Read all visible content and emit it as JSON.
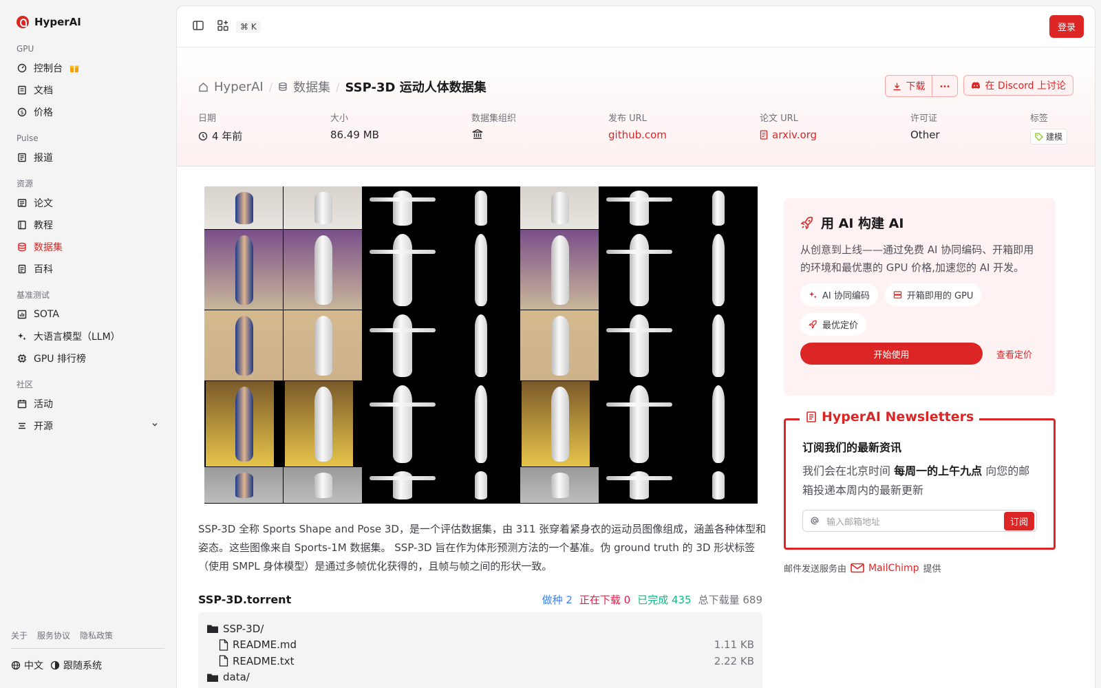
{
  "sidebar": {
    "brand": "HyperAI",
    "sections": [
      {
        "title": "GPU"
      },
      {
        "title": "Pulse"
      },
      {
        "title": "资源"
      },
      {
        "title": "基准测试"
      },
      {
        "title": "社区"
      }
    ],
    "items": {
      "console": "控制台",
      "docs": "文档",
      "pricing": "价格",
      "news": "报道",
      "papers": "论文",
      "tutorials": "教程",
      "datasets": "数据集",
      "wiki": "百科",
      "sota": "SOTA",
      "llm": "大语言模型（LLM）",
      "gpu_rank": "GPU 排行榜",
      "events": "活动",
      "open_source": "开源"
    },
    "footer_links": [
      "关于",
      "服务协议",
      "隐私政策"
    ],
    "language": "中文",
    "theme": "跟随系统"
  },
  "topbar": {
    "shortcut": "⌘ K",
    "login": "登录"
  },
  "breadcrumb": {
    "home": "HyperAI",
    "datasets": "数据集",
    "current": "SSP-3D 运动人体数据集"
  },
  "actions": {
    "download": "下载",
    "discord": "在 Discord 上讨论"
  },
  "meta": {
    "date_label": "日期",
    "date_value": "4 年前",
    "size_label": "大小",
    "size_value": "86.49 MB",
    "org_label": "数据集组织",
    "release_label": "发布 URL",
    "release_value": "github.com",
    "paper_label": "论文 URL",
    "paper_value": "arxiv.org",
    "license_label": "许可证",
    "license_value": "Other",
    "tags_label": "标签",
    "tag_value": "建模"
  },
  "description": "SSP-3D 全称 Sports Shape and Pose 3D，是一个评估数据集，由 311 张穿着紧身衣的运动员图像组成，涵盖各种体型和姿态。这些图像来自 Sports-1M 数据集。 SSP-3D 旨在作为体形预测方法的一个基准。伪 ground truth 的 3D 形状标签（使用 SMPL 身体模型）是通过多帧优化获得的，且帧与帧之间的形状一致。",
  "torrent": {
    "name": "SSP-3D.torrent",
    "seeding": "做种 2",
    "downloading": "正在下载 0",
    "completed": "已完成 435",
    "total": "总下载量 689",
    "colors": {
      "seeding": "#3b82f6",
      "downloading": "#e11d48",
      "completed": "#10b981",
      "total": "#71717a"
    },
    "files": [
      {
        "name": "SSP-3D/",
        "size": "",
        "type": "folder"
      },
      {
        "name": "README.md",
        "size": "1.11 KB",
        "type": "file"
      },
      {
        "name": "README.txt",
        "size": "2.22 KB",
        "type": "file"
      },
      {
        "name": "data/",
        "size": "",
        "type": "folder"
      }
    ]
  },
  "promo": {
    "title": "用 AI 构建 AI",
    "text": "从创意到上线——通过免费 AI 协同编码、开箱即用的环境和最优惠的 GPU 价格,加速您的 AI 开发。",
    "chips": [
      "AI 协同编码",
      "开箱即用的 GPU",
      "最优定价"
    ],
    "start": "开始使用",
    "pricing": "查看定价"
  },
  "newsletter": {
    "legend": "HyperAI Newsletters",
    "title": "订阅我们的最新资讯",
    "text_a": "我们会在北京时间 ",
    "text_b": "每周一的上午九点",
    "text_c": " 向您的邮箱投递本周内的最新更新",
    "placeholder": "输入邮箱地址",
    "subscribe": "订阅"
  },
  "mailchimp": {
    "pre": "邮件发送服务由",
    "brand": "MailChimp",
    "post": "提供"
  },
  "accent": "#dc2626"
}
